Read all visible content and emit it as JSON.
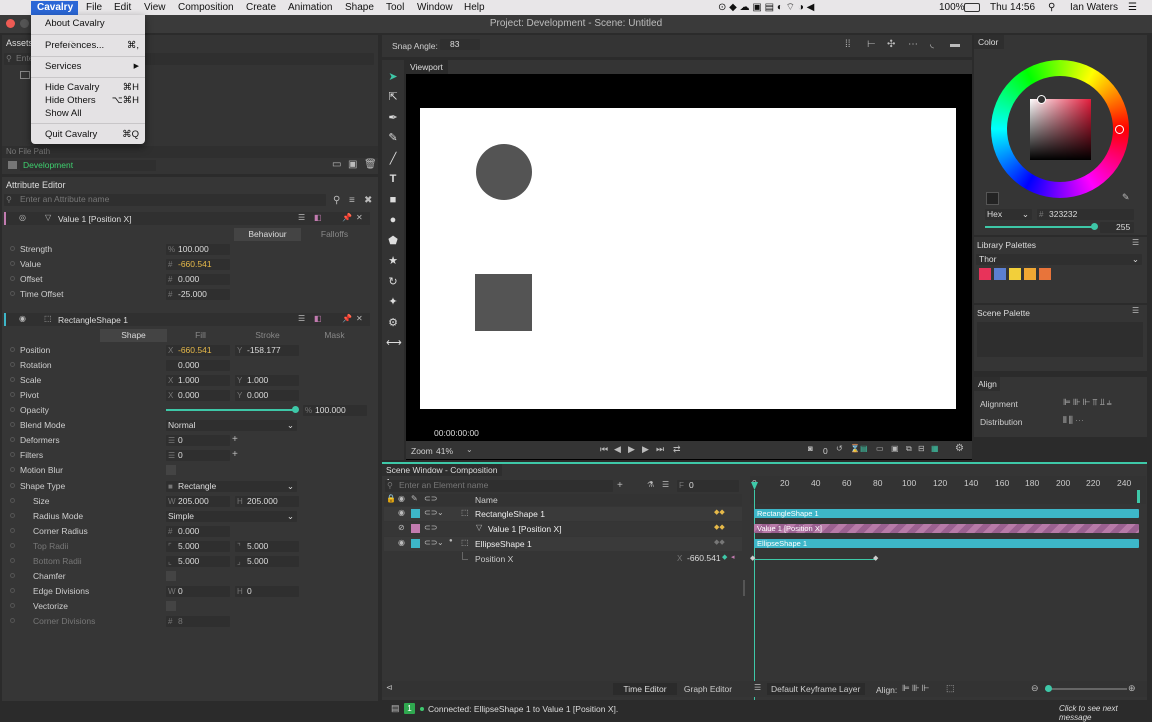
{
  "menubar": {
    "apple": "",
    "items": [
      "Cavalry",
      "File",
      "Edit",
      "View",
      "Composition",
      "Create",
      "Animation",
      "Shape",
      "Tool",
      "Window",
      "Help"
    ],
    "battery": "100%",
    "clock": "Thu 14:56",
    "user": "Ian Waters"
  },
  "app_menu": {
    "about": "About Cavalry",
    "prefs": "Preferences...",
    "prefs_sc": "⌘,",
    "services": "Services",
    "services_arrow": "▶",
    "hide": "Hide Cavalry",
    "hide_sc": "⌘H",
    "hide_others": "Hide Others",
    "hide_others_sc": "⌥⌘H",
    "show_all": "Show All",
    "quit": "Quit Cavalry",
    "quit_sc": "⌘Q"
  },
  "window_title": "Project: Development - Scene: Untitled",
  "assets": {
    "tab": "Assets",
    "search_placeholder": "Enter...",
    "file_path": "No File Path",
    "project": "Development"
  },
  "attribute_editor": {
    "title": "Attribute Editor",
    "search_placeholder": "Enter an Attribute name",
    "value_node": {
      "name": "Value 1 [Position X]",
      "tabs": [
        "Behaviour",
        "Falloffs"
      ],
      "rows": [
        {
          "label": "Strength",
          "prefix": "%",
          "value": "100.000"
        },
        {
          "label": "Value",
          "prefix": "#",
          "value": "-660.541"
        },
        {
          "label": "Offset",
          "prefix": "#",
          "value": "0.000"
        },
        {
          "label": "Time Offset",
          "prefix": "#",
          "value": "-25.000"
        }
      ]
    },
    "shape_node": {
      "name": "RectangleShape 1",
      "tabs": [
        "Shape",
        "Fill",
        "Stroke",
        "Mask"
      ],
      "position": {
        "label": "Position",
        "x": "-660.541",
        "y": "-158.177"
      },
      "rotation": {
        "label": "Rotation",
        "value": "0.000"
      },
      "scale": {
        "label": "Scale",
        "x": "1.000",
        "y": "1.000"
      },
      "pivot": {
        "label": "Pivot",
        "x": "0.000",
        "y": "0.000"
      },
      "opacity": {
        "label": "Opacity",
        "value": "100.000",
        "level": 1.0
      },
      "blend": {
        "label": "Blend Mode",
        "value": "Normal"
      },
      "deformers": {
        "label": "Deformers",
        "value": "0"
      },
      "filters": {
        "label": "Filters",
        "value": "0"
      },
      "motion_blur": {
        "label": "Motion Blur"
      },
      "shape_type": {
        "label": "Shape Type",
        "value": "Rectangle"
      },
      "size": {
        "label": "Size",
        "w": "205.000",
        "h": "205.000"
      },
      "radius_mode": {
        "label": "Radius Mode",
        "value": "Simple"
      },
      "corner_radius": {
        "label": "Corner Radius",
        "value": "0.000"
      },
      "top_radii": {
        "label": "Top Radii",
        "a": "5.000",
        "b": "5.000"
      },
      "bottom_radii": {
        "label": "Bottom Radii",
        "a": "5.000",
        "b": "5.000"
      },
      "chamfer": {
        "label": "Chamfer"
      },
      "edge_divisions": {
        "label": "Edge Divisions",
        "w": "0",
        "h": "0"
      },
      "vectorize": {
        "label": "Vectorize"
      },
      "corner_divisions": {
        "label": "Corner Divisions",
        "value": "8"
      }
    }
  },
  "viewport": {
    "snap_label": "Snap Angle:",
    "snap_value": "83",
    "tab": "Viewport",
    "timecode": "00:00:00:00",
    "zoom_label": "Zoom",
    "zoom_value": "41%",
    "frame": "0",
    "canvas_colors": {
      "background": "#ffffff",
      "shape": "#545454"
    }
  },
  "color_panel": {
    "title": "Color",
    "mode": "Hex",
    "hex": "323232",
    "alpha": "255",
    "library_title": "Library Palettes",
    "palette_name": "Thor",
    "swatches": [
      "#e8335a",
      "#5b7fd1",
      "#f2cf3a",
      "#f0a733",
      "#e8743a"
    ],
    "scene_palette": "Scene Palette"
  },
  "align_panel": {
    "title": "Align",
    "alignment": "Alignment",
    "distribution": "Distribution"
  },
  "scene_window": {
    "title": "Scene Window - Composition 1",
    "search_placeholder": "Enter an Element name",
    "frame_field": "0",
    "name_col": "Name",
    "rows": [
      {
        "name": "RectangleShape 1",
        "color": "#3db6c8"
      },
      {
        "name": "Value 1 [Position X]",
        "color": "#c27bb0"
      },
      {
        "name": "EllipseShape 1",
        "color": "#3db6c8"
      },
      {
        "name": "Position X",
        "value": "-660.541"
      }
    ],
    "ticks": [
      "0",
      "20",
      "40",
      "60",
      "80",
      "100",
      "120",
      "140",
      "160",
      "180",
      "200",
      "220",
      "240"
    ],
    "bars": [
      "RectangleShape 1",
      "Value 1 [Position X]",
      "EllipseShape 1"
    ],
    "time_editor": "Time Editor",
    "graph_editor": "Graph Editor",
    "keyframe_layer": "Default Keyframe Layer",
    "align": "Align:"
  },
  "status": {
    "badge": "1",
    "message": "Connected: EllipseShape 1 to Value 1 [Position X].",
    "hint": "Click to see next message"
  }
}
